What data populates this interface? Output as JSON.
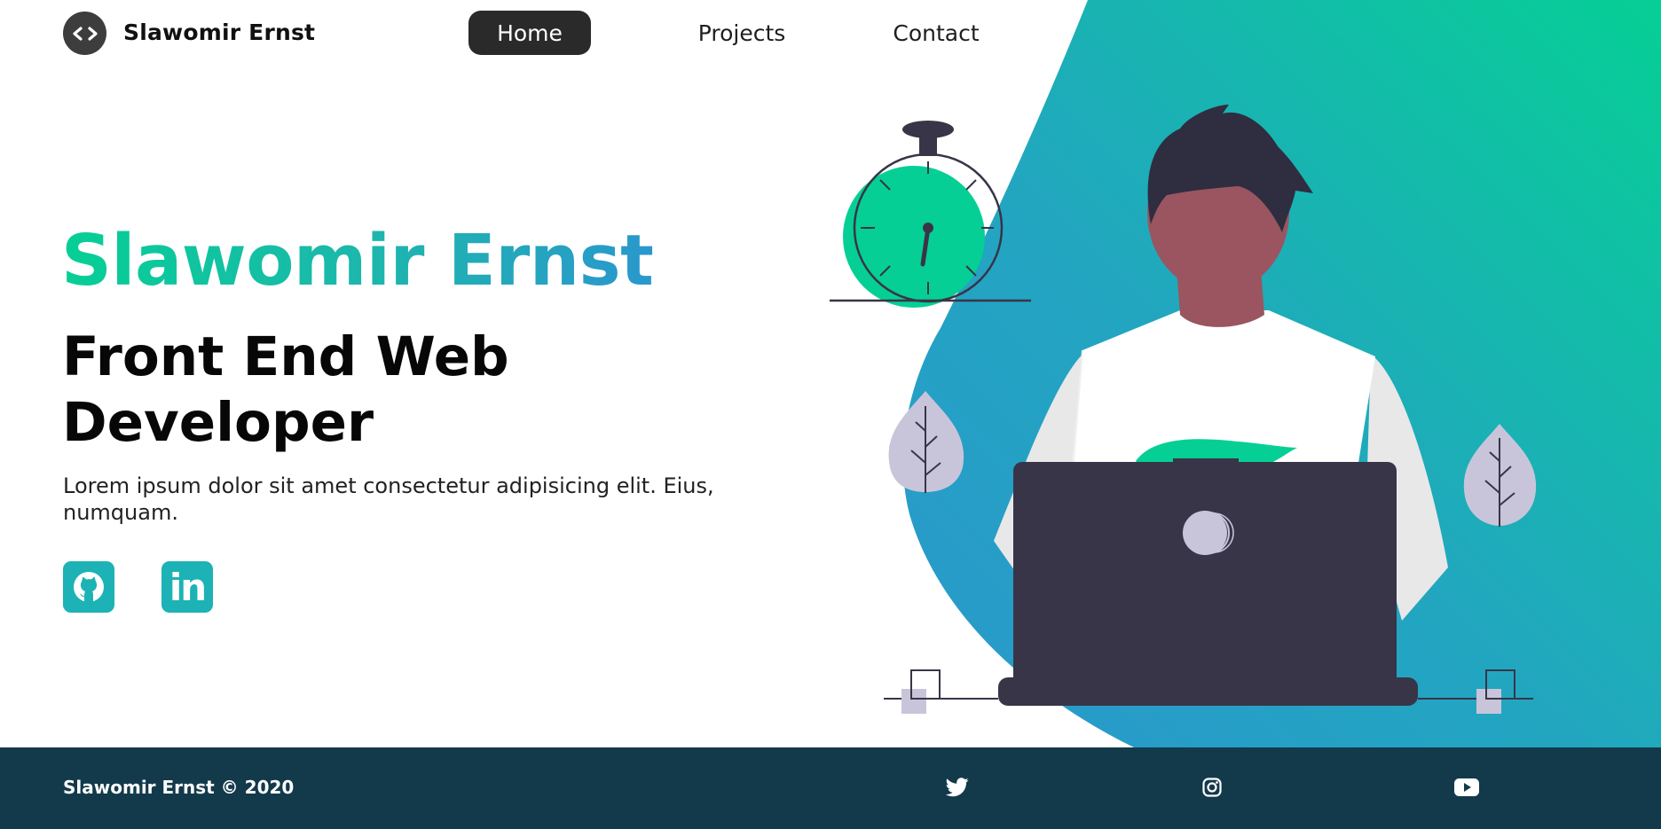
{
  "header": {
    "logo_icon": "code-brackets-icon",
    "brand": "Slawomir Ernst",
    "nav": {
      "home": "Home",
      "projects": "Projects",
      "contact": "Contact"
    },
    "active_nav": "Home"
  },
  "hero": {
    "name": "Slawomir Ernst",
    "role": "Front End Web Developer",
    "description": "Lorem ipsum dolor sit amet consectetur adipisicing elit. Eius, numquam.",
    "social": [
      {
        "icon": "github-icon"
      },
      {
        "icon": "linkedin-icon",
        "glyph": "in"
      }
    ]
  },
  "illustration": {
    "subject": "person working on laptop with stopwatch and plants",
    "colors": {
      "gradient_start": "#06cf95",
      "gradient_end": "#2a97cd",
      "dark": "#383548",
      "skin": "#9a5560",
      "leaf": "#c8c5da"
    }
  },
  "footer": {
    "copyright": "Slawomir Ernst © 2020",
    "social": [
      {
        "icon": "twitter-icon"
      },
      {
        "icon": "instagram-icon"
      },
      {
        "icon": "youtube-icon"
      }
    ],
    "background": "#133a4b"
  }
}
